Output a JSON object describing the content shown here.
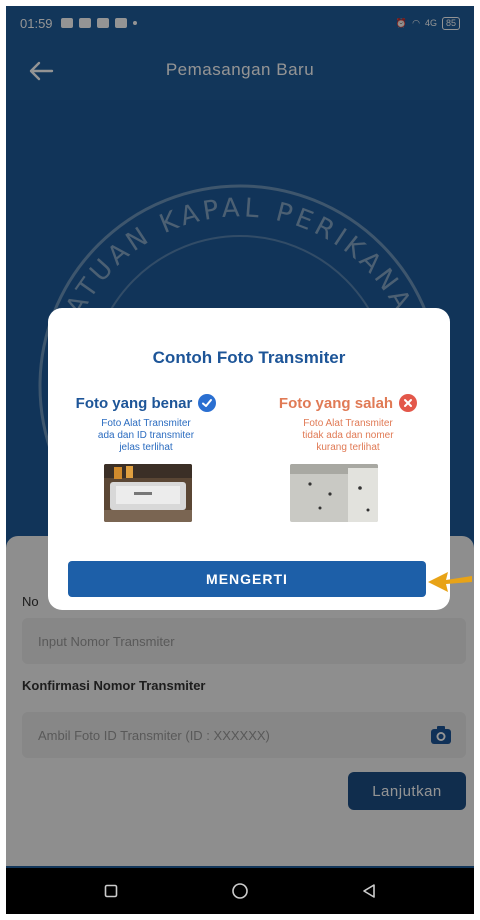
{
  "status_bar": {
    "time": "01:59",
    "battery": "85",
    "network": "4G"
  },
  "app_bar": {
    "title": "Pemasangan Baru"
  },
  "emblem": {
    "text": "SATUAN KAPAL PERIKANAN"
  },
  "form": {
    "field1_label_partial": "No",
    "field1_placeholder": "Input Nomor Transmiter",
    "field2_label": "Konfirmasi Nomor Transmiter",
    "field2_placeholder": "Ambil Foto ID Transmiter (ID : XXXXXX)",
    "next_button": "Lanjutkan"
  },
  "dialog": {
    "title": "Contoh Foto Transmiter",
    "correct": {
      "heading": "Foto yang benar",
      "line1": "Foto Alat Transmiter",
      "line2": "ada dan ID transmiter",
      "line3": "jelas terlihat"
    },
    "wrong": {
      "heading": "Foto yang salah",
      "line1": "Foto Alat Transmiter",
      "line2": "tidak ada dan nomer",
      "line3": "kurang terlihat"
    },
    "ok_button": "MENGERTI"
  },
  "colors": {
    "primary": "#1f5d9c",
    "accent_correct": "#2a6fd1",
    "accent_wrong": "#e3574a",
    "arrow": "#e8a317"
  }
}
